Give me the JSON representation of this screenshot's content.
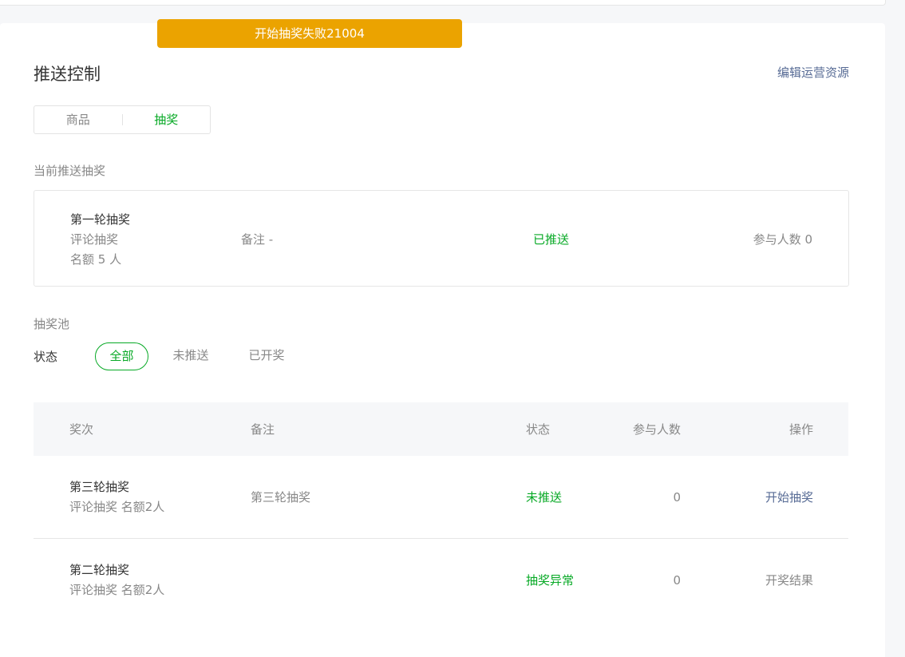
{
  "toast": {
    "message": "开始抽奖失败21004"
  },
  "header": {
    "title": "推送控制",
    "edit_link": "编辑运营资源"
  },
  "tabs": [
    {
      "label": "商品",
      "active": false
    },
    {
      "label": "抽奖",
      "active": true
    }
  ],
  "current": {
    "section_title": "当前推送抽奖",
    "name": "第一轮抽奖",
    "type": "评论抽奖",
    "quota": "名额 5 人",
    "remark": "备注 -",
    "status": "已推送",
    "participants": "参与人数 0"
  },
  "pool": {
    "section_title": "抽奖池",
    "filter_label": "状态",
    "filters": [
      {
        "label": "全部",
        "active": true
      },
      {
        "label": "未推送",
        "active": false
      },
      {
        "label": "已开奖",
        "active": false
      }
    ]
  },
  "table": {
    "columns": {
      "round": "奖次",
      "remark": "备注",
      "status": "状态",
      "participants": "参与人数",
      "action": "操作"
    },
    "rows": [
      {
        "name": "第三轮抽奖",
        "sub": "评论抽奖 名额2人",
        "remark": "第三轮抽奖",
        "status": "未推送",
        "count": "0",
        "action": "开始抽奖"
      },
      {
        "name": "第二轮抽奖",
        "sub": "评论抽奖 名额2人",
        "remark": "",
        "status": "抽奖异常",
        "count": "0",
        "action": "开奖结果"
      }
    ]
  },
  "colors": {
    "accent_green": "#07a925",
    "link_blue": "#576b95",
    "toast_orange": "#eba300"
  }
}
